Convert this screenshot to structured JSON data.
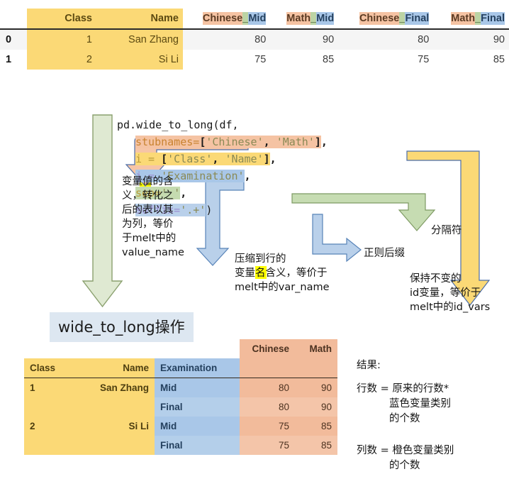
{
  "source_table": {
    "index_header": "",
    "columns": [
      {
        "label": "Class",
        "group": "id"
      },
      {
        "label": "Name",
        "group": "id"
      },
      {
        "label": "Chinese_Mid",
        "stub": "Chinese",
        "sep": "_",
        "suffix": "Mid"
      },
      {
        "label": "Math_Mid",
        "stub": "Math",
        "sep": "_",
        "suffix": "Mid"
      },
      {
        "label": "Chinese_Final",
        "stub": "Chinese",
        "sep": "_",
        "suffix": "Final"
      },
      {
        "label": "Math_Final",
        "stub": "Math",
        "sep": "_",
        "suffix": "Final"
      }
    ],
    "rows": [
      {
        "index": "0",
        "Class": "1",
        "Name": "San Zhang",
        "Chinese_Mid": "80",
        "Math_Mid": "90",
        "Chinese_Final": "80",
        "Math_Final": "90"
      },
      {
        "index": "1",
        "Class": "2",
        "Name": "Si Li",
        "Chinese_Mid": "75",
        "Math_Mid": "85",
        "Chinese_Final": "75",
        "Math_Final": "85"
      }
    ]
  },
  "code": {
    "line1": "pd.wide_to_long(df,",
    "line2_text": "stubnames=['Chinese', 'Math'],",
    "line2": {
      "name": "stubnames=",
      "open": "[",
      "v1": "'Chinese'",
      "comma": ", ",
      "v2": "'Math'",
      "close": "]",
      "tail": ","
    },
    "line3": {
      "name": "i = ",
      "open": "[",
      "v1": "'Class'",
      "comma": ", ",
      "v2": "'Name'",
      "close": "]",
      "tail": ","
    },
    "line3_text": "i = ['Class', 'Name'],",
    "line4": {
      "name": "j = ",
      "v1": "'Examination'",
      "tail": ","
    },
    "line4_text": "j = 'Examination',",
    "line5": {
      "name": "sep=",
      "v1": "'_'",
      "tail": ","
    },
    "line5_text": "sep='_',",
    "line6": {
      "name": "suffix=",
      "v1": "'.+'",
      "tail": ")"
    },
    "line6_text": "suffix='.+')"
  },
  "annotations": {
    "value_meaning": [
      "变量值的含",
      "义，转化之",
      "后的表以其",
      "为列，等价",
      "于melt中的",
      "value_name"
    ],
    "value_meaning_highlight": "值",
    "var_meaning": [
      "压缩到行的",
      "变量名含义，等价于",
      "melt中的var_name"
    ],
    "var_meaning_highlight": "名",
    "separator": "分隔符",
    "regex_suffix": "正则后缀",
    "id_vars": [
      "保持不变的",
      "id变量，等价于",
      "melt中的id_vars"
    ]
  },
  "operation_label": "wide_to_long操作",
  "result_table": {
    "group_headers": [
      {
        "label": "Chinese",
        "color": "#f2bb9b"
      },
      {
        "label": "Math",
        "color": "#f2bb9b"
      }
    ],
    "columns": [
      "Class",
      "Name",
      "Examination",
      "Chinese",
      "Math"
    ],
    "rows": [
      {
        "Class": "1",
        "Name": "San Zhang",
        "Examination": "Mid",
        "Chinese": "80",
        "Math": "90"
      },
      {
        "Class": "",
        "Name": "",
        "Examination": "Final",
        "Chinese": "80",
        "Math": "90"
      },
      {
        "Class": "2",
        "Name": "Si Li",
        "Examination": "Mid",
        "Chinese": "75",
        "Math": "85"
      },
      {
        "Class": "",
        "Name": "",
        "Examination": "Final",
        "Chinese": "75",
        "Math": "85"
      }
    ]
  },
  "result_notes": {
    "title": "结果:",
    "rows_line1": "行数 = 原来的行数*",
    "rows_line2": "蓝色变量类别",
    "rows_line3": "的个数",
    "cols_line1": "列数 = 橙色变量类别",
    "cols_line2": "的个数"
  },
  "colors": {
    "yellow": "#fbd976",
    "orange": "#f5c3a3",
    "blue": "#a9c7e8",
    "green": "#bcd4a4",
    "label_bg": "#dde7f1",
    "highlight": "#ffff00"
  }
}
